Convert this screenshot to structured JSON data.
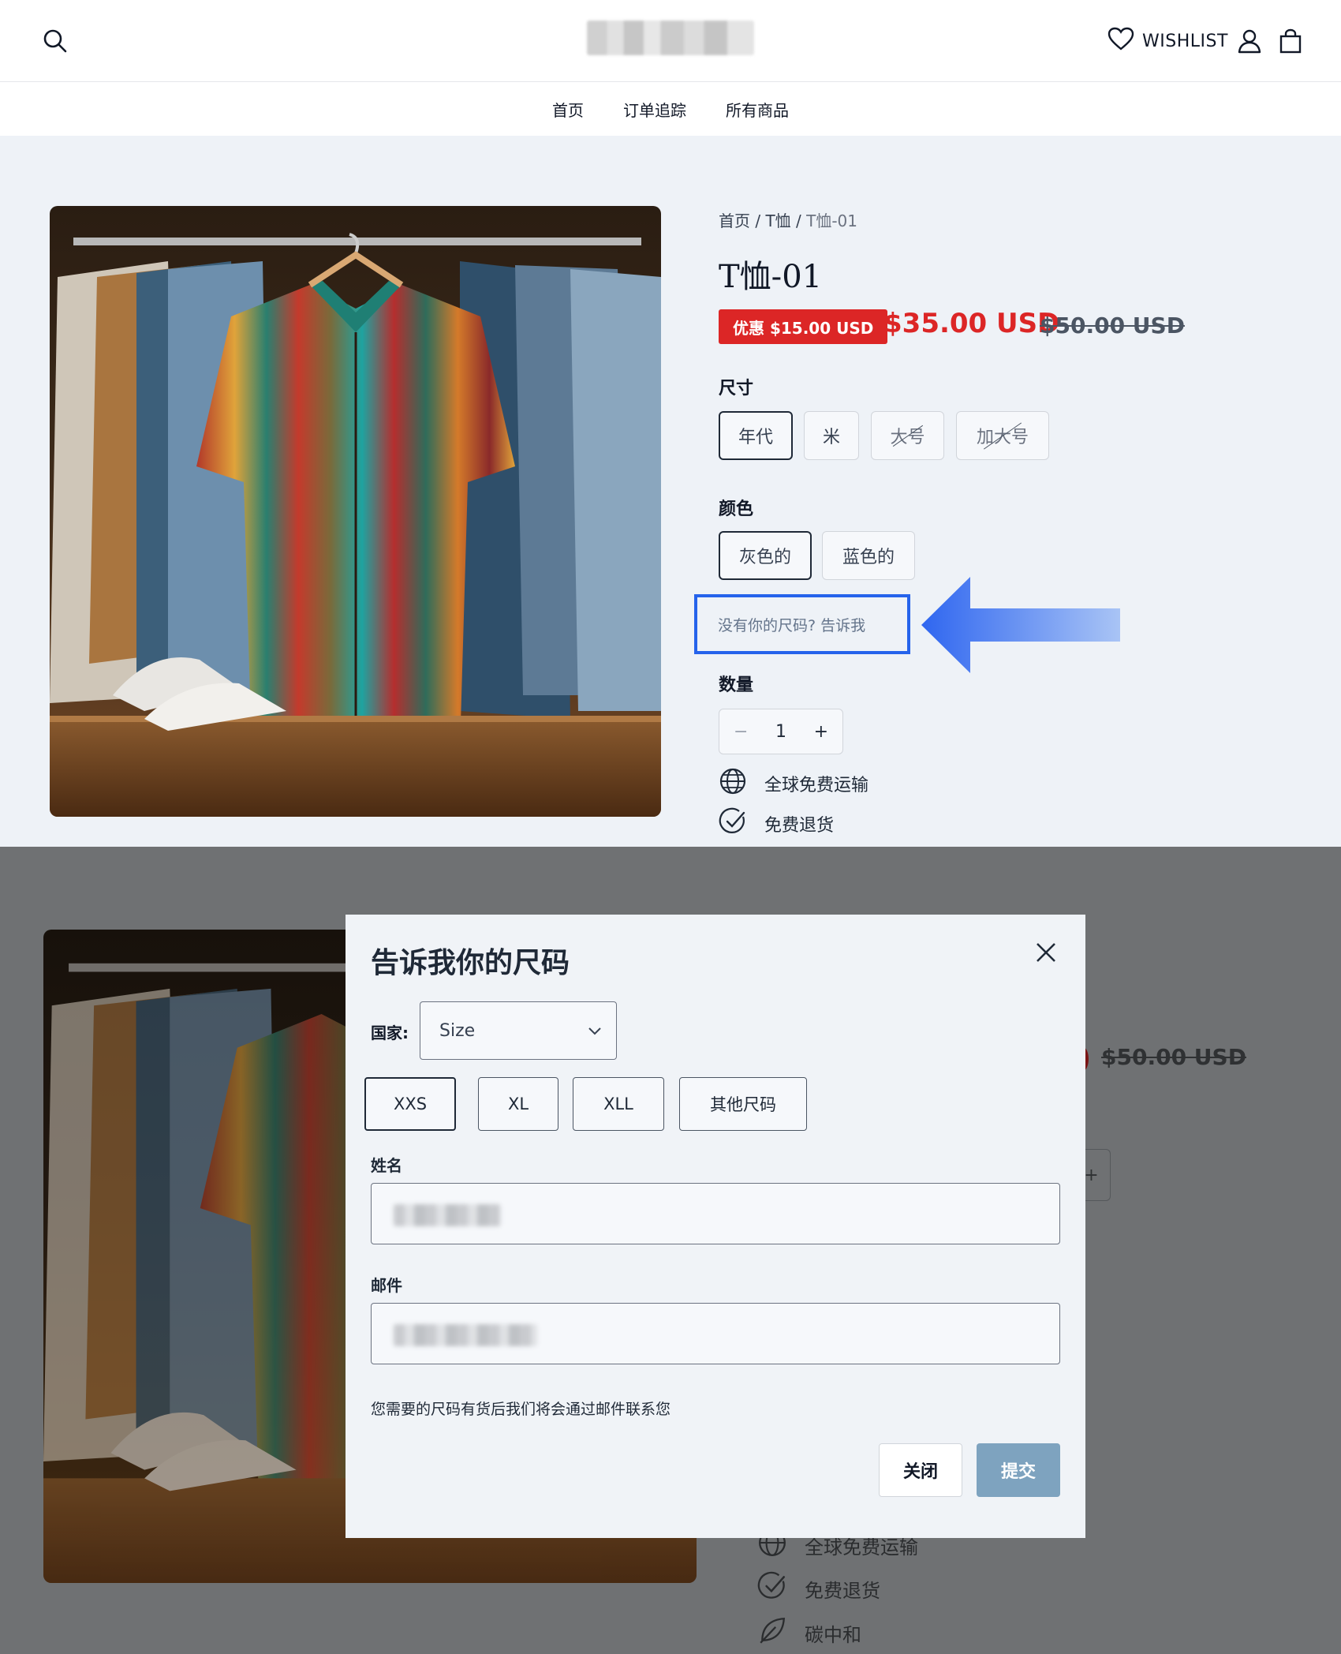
{
  "header": {
    "wishlist_label": "WISHLIST"
  },
  "nav": {
    "items": [
      "首页",
      "订单追踪",
      "所有商品"
    ]
  },
  "product": {
    "breadcrumb": {
      "home": "首页",
      "sep1": " / ",
      "category": "T恤",
      "sep2": " / ",
      "current": "T恤-01"
    },
    "title": "T恤-01",
    "sale_badge": "优惠 $15.00 USD",
    "price_now": "$35.00 USD",
    "price_was": "$50.00 USD",
    "size_label": "尺寸",
    "sizes": [
      {
        "label": "年代",
        "state": "selected"
      },
      {
        "label": "米",
        "state": "available"
      },
      {
        "label": "大号",
        "state": "unavailable"
      },
      {
        "label": "加大号",
        "state": "unavailable"
      }
    ],
    "color_label": "颜色",
    "colors": [
      {
        "label": "灰色的",
        "state": "selected"
      },
      {
        "label": "蓝色的",
        "state": "available"
      }
    ],
    "size_request_link": "没有你的尺码?  告诉我",
    "quantity_label": "数量",
    "quantity": {
      "minus": "−",
      "value": "1",
      "plus": "+"
    },
    "features": [
      {
        "icon": "globe-icon",
        "label": "全球免费运输"
      },
      {
        "icon": "check-circle-icon",
        "label": "免费退货"
      },
      {
        "icon": "leaf-icon",
        "label": "碳中和"
      }
    ]
  },
  "modal": {
    "title": "告诉我你的尺码",
    "country_label": "国家:",
    "select_value": "Size",
    "size_options": [
      {
        "label": "XXS",
        "state": "selected"
      },
      {
        "label": "XL",
        "state": "available"
      },
      {
        "label": "XLL",
        "state": "available"
      },
      {
        "label": "其他尺码",
        "state": "available"
      }
    ],
    "name_label": "姓名",
    "email_label": "邮件",
    "note": "您需要的尺码有货后我们将会通过邮件联系您",
    "close_button": "关闭",
    "submit_button": "提交"
  },
  "colors": {
    "sale_red": "#dc2626",
    "highlight_blue": "#2563eb",
    "submit_button": "#7ea3bf",
    "overlay": "#6f7173"
  }
}
